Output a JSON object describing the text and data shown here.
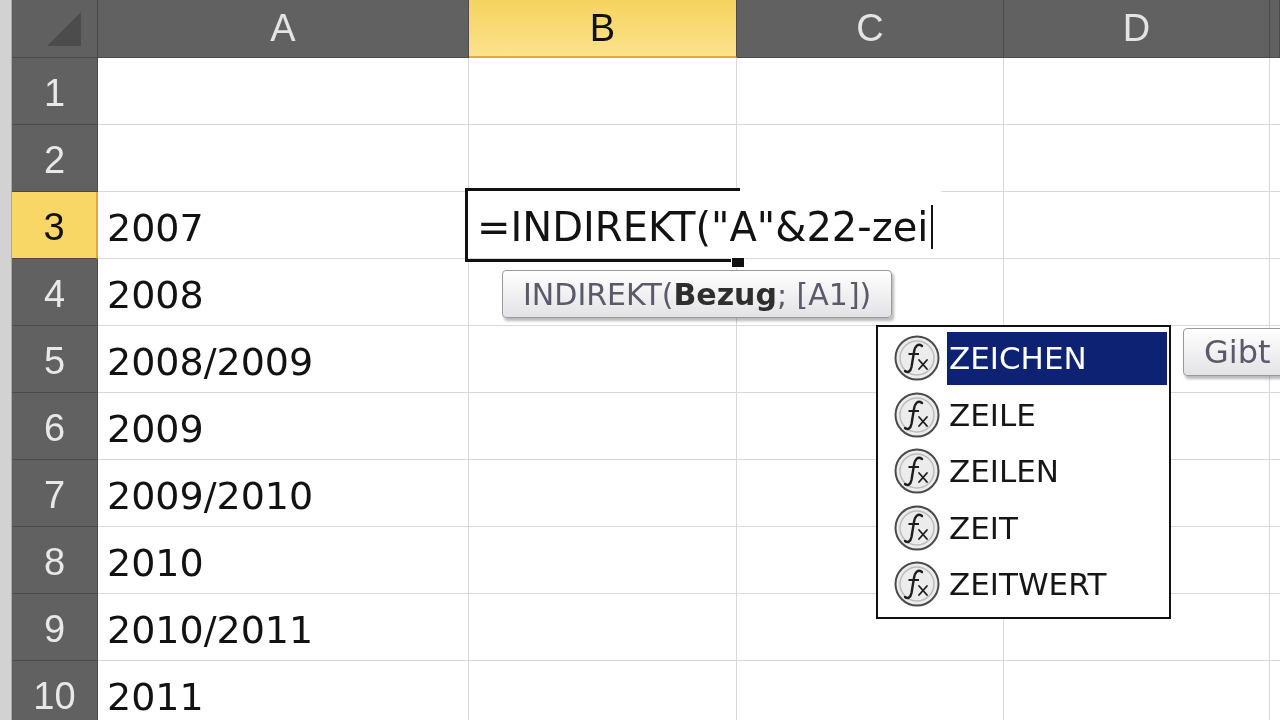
{
  "column_headers": [
    {
      "label": "A",
      "selected": false
    },
    {
      "label": "B",
      "selected": true
    },
    {
      "label": "C",
      "selected": false
    },
    {
      "label": "D",
      "selected": false
    }
  ],
  "rows": [
    {
      "number": "1",
      "selected": false
    },
    {
      "number": "2",
      "selected": false
    },
    {
      "number": "3",
      "selected": true,
      "cells": [
        "2007"
      ]
    },
    {
      "number": "4",
      "selected": false,
      "cells": [
        "2008"
      ]
    },
    {
      "number": "5",
      "selected": false,
      "cells": [
        "2008/2009"
      ]
    },
    {
      "number": "6",
      "selected": false,
      "cells": [
        "2009"
      ]
    },
    {
      "number": "7",
      "selected": false,
      "cells": [
        "2009/2010"
      ]
    },
    {
      "number": "8",
      "selected": false,
      "cells": [
        "2010"
      ]
    },
    {
      "number": "9",
      "selected": false,
      "cells": [
        "2010/2011"
      ]
    },
    {
      "number": "10",
      "selected": false,
      "cells": [
        "2011"
      ]
    }
  ],
  "editor": {
    "value": "=INDIREKT(\"A\"&22-zei"
  },
  "syntax_tooltip": {
    "text": "INDIREKT(**Bezug**; [A1])"
  },
  "autocomplete": {
    "items": [
      {
        "label": "ZEICHEN",
        "selected": true
      },
      {
        "label": "ZEILE",
        "selected": false
      },
      {
        "label": "ZEILEN",
        "selected": false
      },
      {
        "label": "ZEIT",
        "selected": false
      },
      {
        "label": "ZEITWERT",
        "selected": false
      }
    ]
  },
  "description_tooltip": {
    "text": "Gibt"
  }
}
